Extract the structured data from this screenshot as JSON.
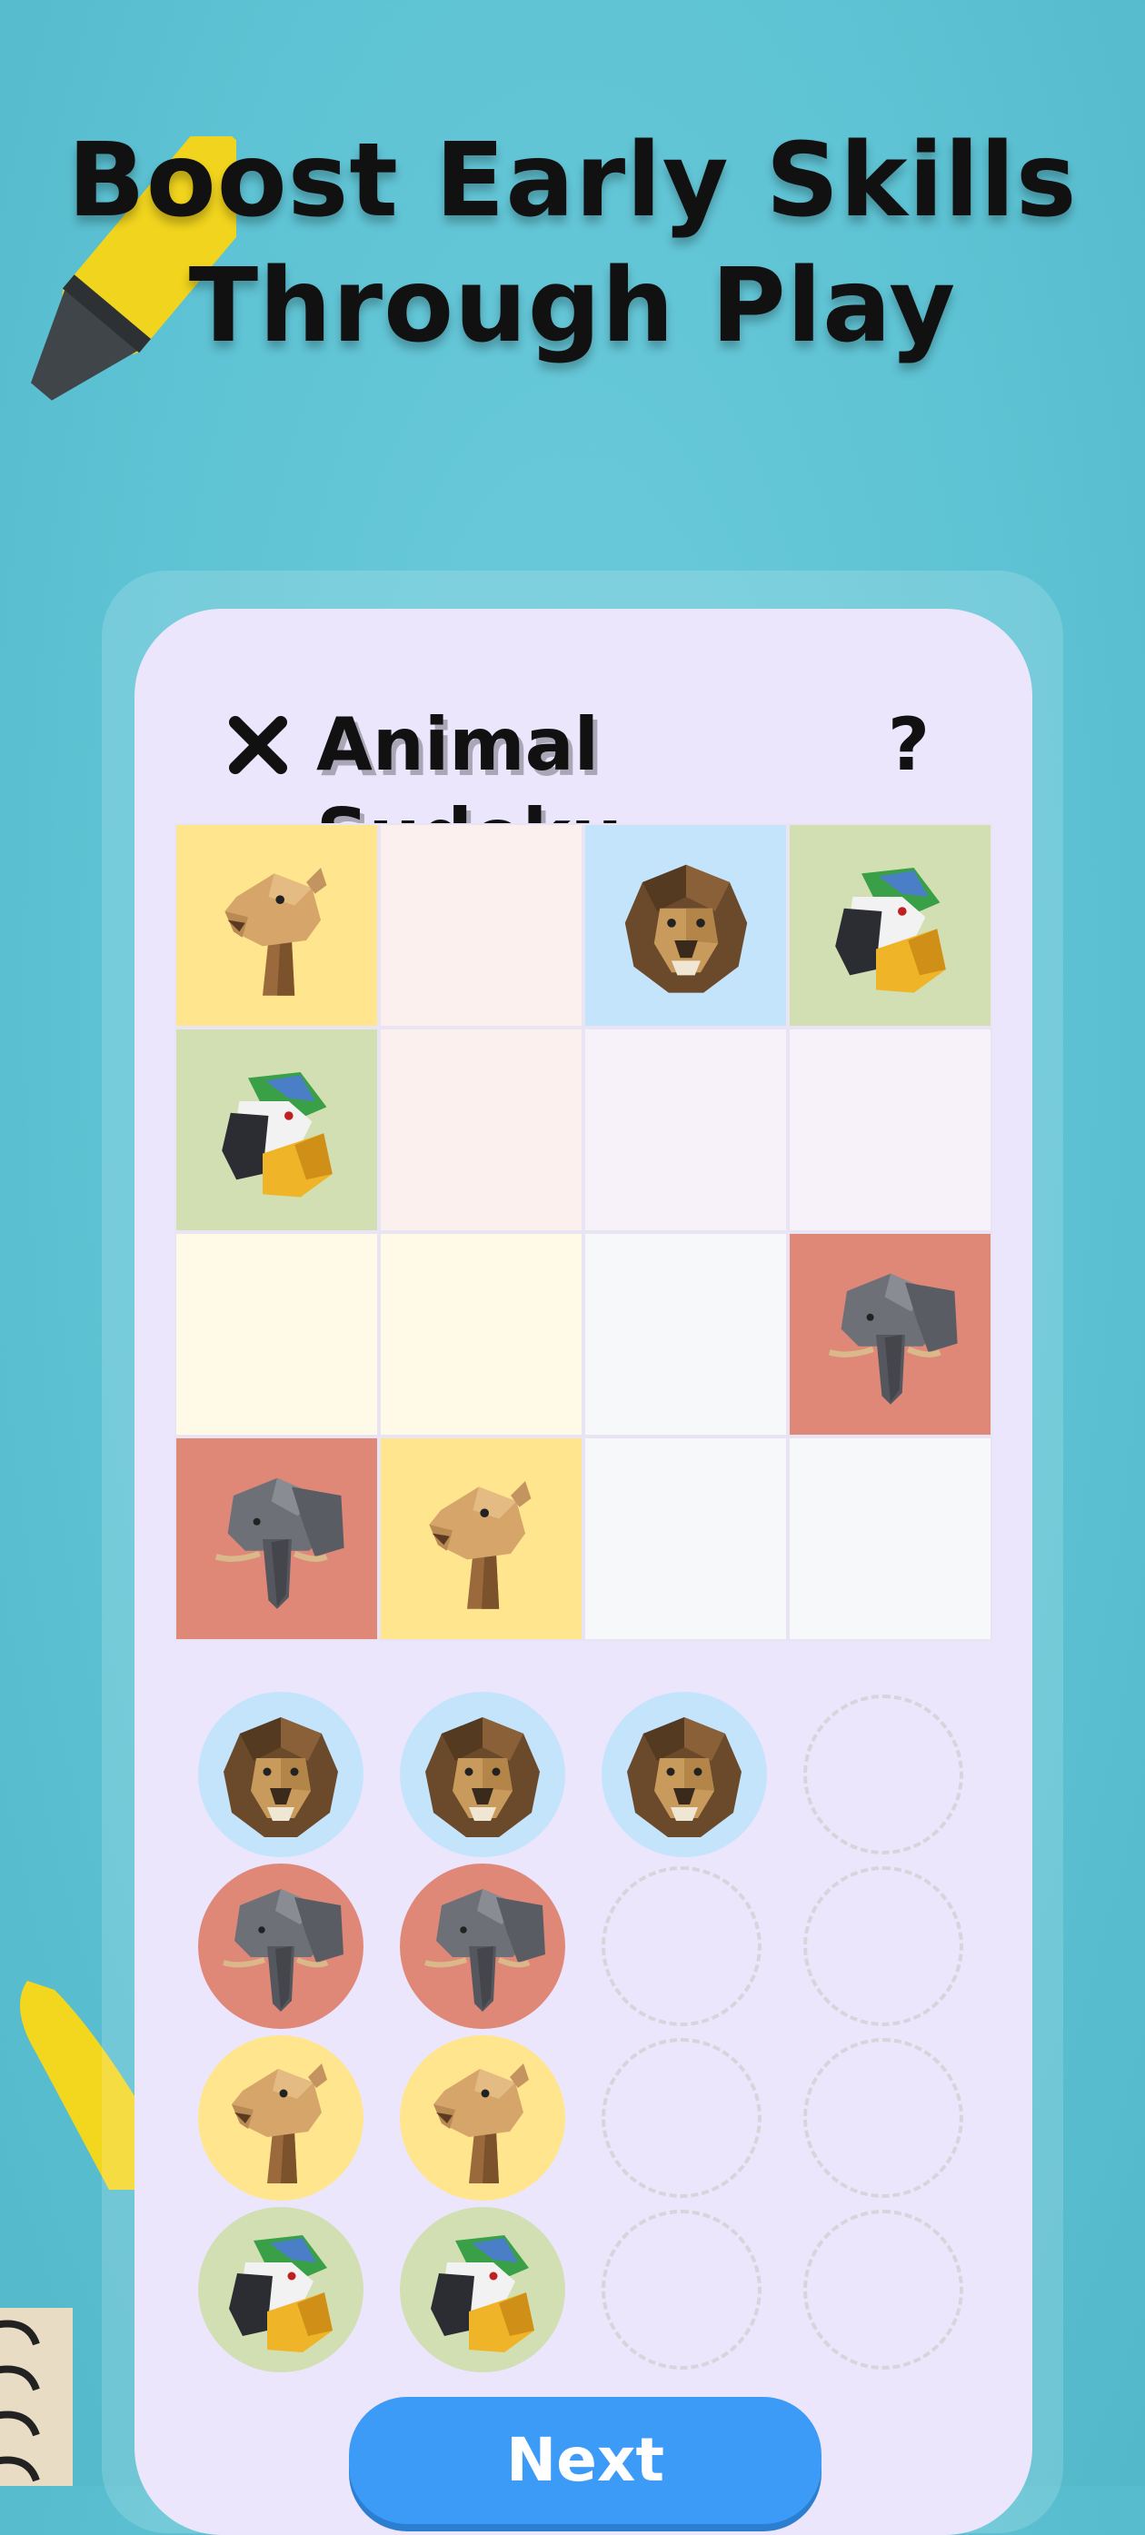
{
  "headline": {
    "line1": "Boost Early Skills",
    "line2": "Through Play"
  },
  "game": {
    "title": "Animal Sudoku",
    "close_icon": "close-icon",
    "help_label": "?",
    "next_label": "Next",
    "animal_colors": {
      "camel": "#ffe58e",
      "lion": "#c4e4fc",
      "parrot": "#d2dfb2",
      "elephant": "#e08878"
    },
    "grid": [
      [
        {
          "animal": "camel"
        },
        {
          "animal": "",
          "bg": "#fcf0ee"
        },
        {
          "animal": "lion"
        },
        {
          "animal": "parrot"
        }
      ],
      [
        {
          "animal": "parrot"
        },
        {
          "animal": "",
          "bg": "#fcf0ee"
        },
        {
          "animal": "",
          "bg": "#f7f1fa"
        },
        {
          "animal": "",
          "bg": "#f7f1fa"
        }
      ],
      [
        {
          "animal": "",
          "bg": "#fffae8"
        },
        {
          "animal": "",
          "bg": "#fffae8"
        },
        {
          "animal": "",
          "bg": "#f6f8fa"
        },
        {
          "animal": "elephant"
        }
      ],
      [
        {
          "animal": "elephant"
        },
        {
          "animal": "camel"
        },
        {
          "animal": "",
          "bg": "#f6f8fa"
        },
        {
          "animal": "",
          "bg": "#f6f8fa"
        }
      ]
    ],
    "tray": [
      [
        "lion",
        "lion",
        "lion",
        ""
      ],
      [
        "elephant",
        "elephant",
        "",
        ""
      ],
      [
        "camel",
        "camel",
        "",
        ""
      ],
      [
        "parrot",
        "parrot",
        "",
        ""
      ]
    ]
  }
}
